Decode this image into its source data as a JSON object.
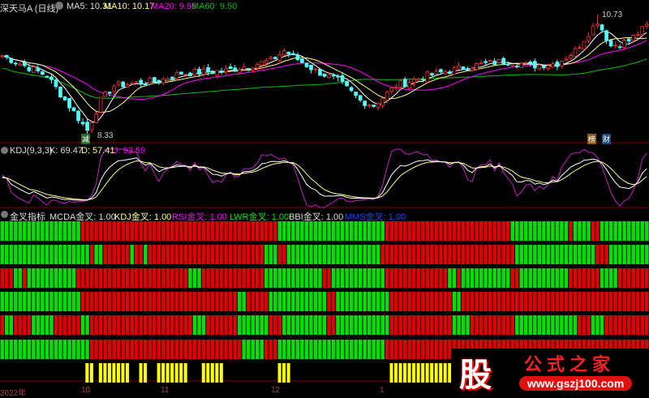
{
  "header": {
    "title": "深天马A (日线)",
    "ma5": "MA5: 10.31",
    "ma10": "MA10: 10.17",
    "ma20": "MA20: 9.98",
    "ma60": "MA60: 9.50"
  },
  "price_marks": {
    "high": "10.73",
    "low": "8.33",
    "low_tag": "减",
    "tag1": "榜",
    "tag2": "财"
  },
  "kdj": {
    "title": "KDJ(9,3,3)",
    "k": "K: 69.47",
    "d": "D: 57.41",
    "j": "J: 93.59"
  },
  "cross": {
    "title": "金叉指标",
    "macd": "MCDA金叉: 1.00",
    "kdj": "KDJ金叉: 1.00",
    "rsi": "RSI金叉: 1.00",
    "lwr": "LWR金叉: 1.00",
    "bbi": "BBI金叉: 1.00",
    "mms": "MMS金叉: 1.00"
  },
  "axis": {
    "labels": [
      "2022年",
      "10",
      "11",
      "12",
      "1"
    ]
  },
  "watermark": {
    "char": "股",
    "name": "公式之家",
    "url": "www.gszj100.com"
  },
  "colors": {
    "up": "#ff3232",
    "down": "#54ffff",
    "ma5": "#ffffff",
    "ma10": "#ffff80",
    "ma20": "#ff00ff",
    "ma60": "#00c000",
    "red": "#e00000",
    "green": "#00e000",
    "yellow": "#ffff00"
  },
  "chart_data": {
    "type": "candlestick",
    "bars": 145,
    "price_keypoints": [
      [
        0,
        9.9
      ],
      [
        10,
        9.5
      ],
      [
        19,
        8.4
      ],
      [
        22,
        9.0
      ],
      [
        25,
        9.3
      ],
      [
        35,
        9.4
      ],
      [
        40,
        9.55
      ],
      [
        50,
        9.6
      ],
      [
        60,
        9.8
      ],
      [
        63,
        10.0
      ],
      [
        70,
        9.6
      ],
      [
        75,
        9.4
      ],
      [
        80,
        9.0
      ],
      [
        83,
        8.9
      ],
      [
        88,
        9.3
      ],
      [
        95,
        9.5
      ],
      [
        105,
        9.7
      ],
      [
        113,
        9.8
      ],
      [
        118,
        9.7
      ],
      [
        124,
        9.75
      ],
      [
        128,
        10.0
      ],
      [
        133,
        10.6
      ],
      [
        136,
        10.1
      ],
      [
        140,
        10.2
      ],
      [
        144,
        10.5
      ]
    ],
    "ylim": [
      8.2,
      10.8
    ],
    "cross_rows": [
      "G18 R44 G24 R28 G13 R1 G4 R2 G11",
      "G20 R1 G2 R6 G1 R2 G1 R26 G3 R2 G21 R30 G18 R3 G9",
      "R3 G2 R1 G11 R25 G3 R14 G13 R2 G12 R14 G2 R1 G11 R2 G11 R7 G4 R7",
      "G18 R35 G2 R5 G13 R2 G12 R14 G2 R42",
      "R1 G2 R4 G5 R6 G2 R23 G3 R7 G7 R3 G10 R2 G12 R14 G4 R10 G14 R3 G3 R10",
      "G20 R34 G5 R3 G24 R14 R45"
    ],
    "signal_ranges": [
      [
        19,
        20
      ],
      [
        22,
        28
      ],
      [
        31,
        32
      ],
      [
        35,
        41
      ],
      [
        45,
        49
      ],
      [
        62,
        64
      ],
      [
        87,
        100
      ]
    ]
  }
}
